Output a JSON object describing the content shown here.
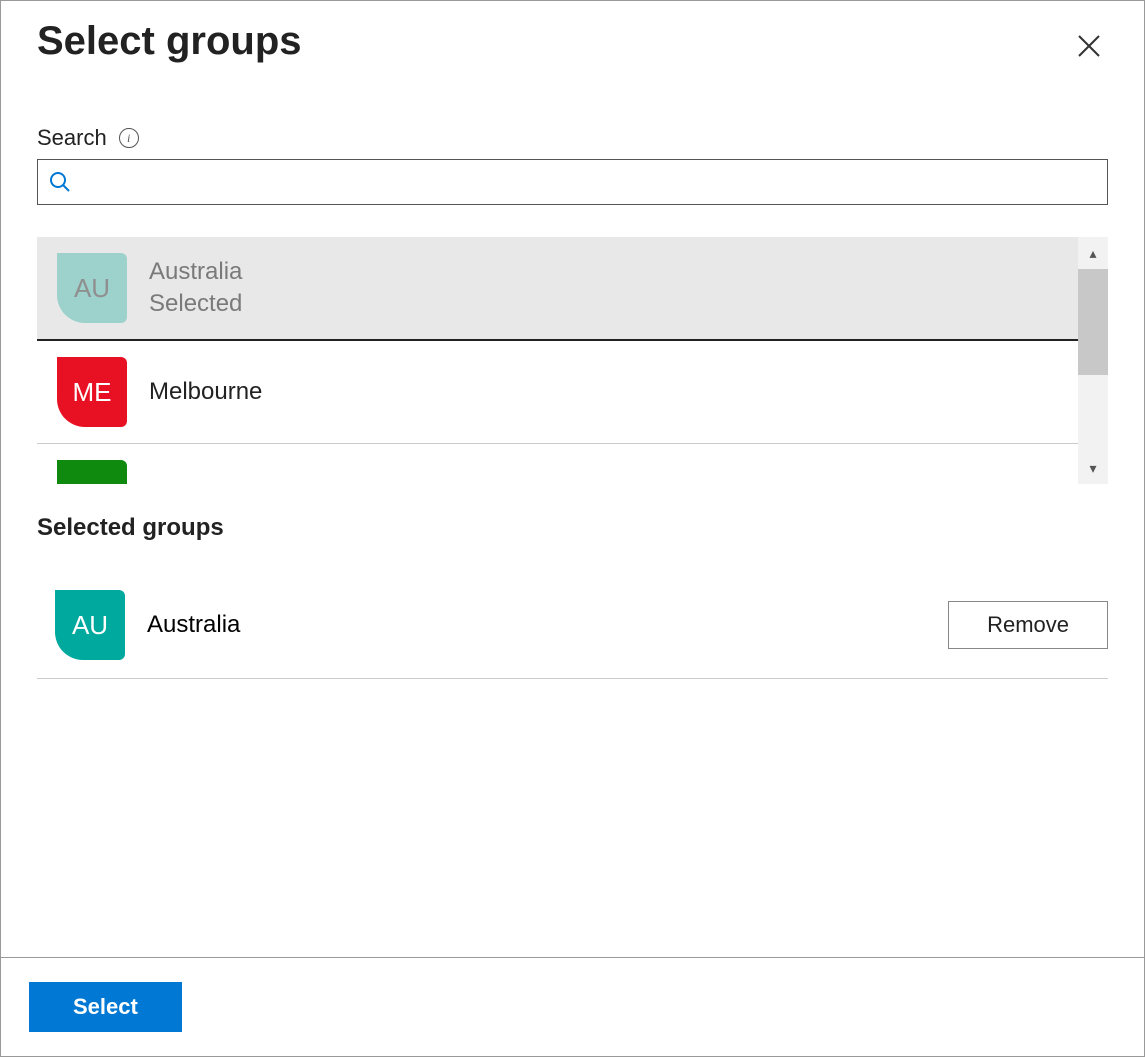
{
  "title": "Select groups",
  "search": {
    "label": "Search",
    "placeholder": ""
  },
  "groups": [
    {
      "initials": "AU",
      "name": "Australia",
      "color": "#6cc2b8",
      "selected": true,
      "status": "Selected"
    },
    {
      "initials": "ME",
      "name": "Melbourne",
      "color": "#e81123",
      "selected": false
    },
    {
      "initials": "",
      "name": "",
      "color": "#0f8a0f",
      "selected": false
    }
  ],
  "selected_heading": "Selected groups",
  "selected_groups": [
    {
      "initials": "AU",
      "name": "Australia",
      "color": "#00a99d"
    }
  ],
  "buttons": {
    "remove": "Remove",
    "select": "Select"
  }
}
